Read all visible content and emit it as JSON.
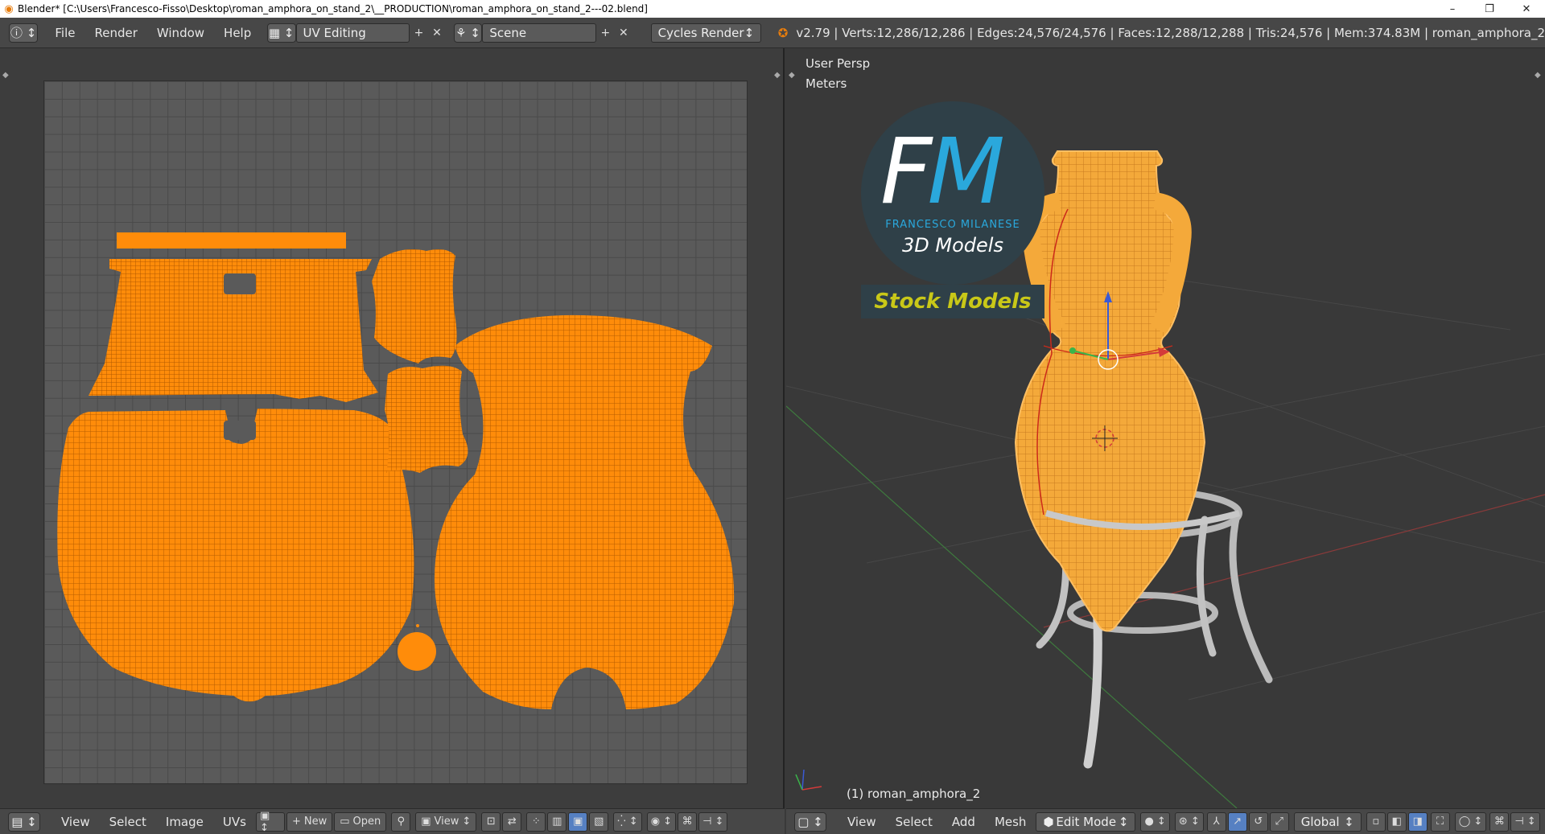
{
  "window": {
    "title": "Blender* [C:\\Users\\Francesco-Fisso\\Desktop\\roman_amphora_on_stand_2\\__PRODUCTION\\roman_amphora_on_stand_2---02.blend]",
    "minimize": "–",
    "maximize": "❐",
    "close": "✕"
  },
  "info_header": {
    "menus": [
      "File",
      "Render",
      "Window",
      "Help"
    ],
    "screen_layout": "UV Editing",
    "scene": "Scene",
    "render_engine": "Cycles Render",
    "stats": "v2.79 | Verts:12,286/12,286 | Edges:24,576/24,576 | Faces:12,288/12,288 | Tris:24,576 | Mem:374.83M | roman_amphora_2"
  },
  "viewport": {
    "view_name": "User Persp",
    "units": "Meters",
    "object_label": "(1) roman_amphora_2"
  },
  "watermark": {
    "letter_f": "F",
    "letter_m": "M",
    "company": "FRANCESCO MILANESE",
    "tagline": "3D Models",
    "badge": "Stock Models"
  },
  "uv_footer": {
    "menus": [
      "View",
      "Select",
      "Image",
      "UVs"
    ],
    "new_label": "New",
    "open_label": "Open",
    "view_label": "View"
  },
  "view3d_footer": {
    "menus": [
      "View",
      "Select",
      "Add",
      "Mesh"
    ],
    "mode": "Edit Mode",
    "orientation": "Global"
  },
  "colors": {
    "uv_orange": "#ff8c0a",
    "mesh_orange": "#f4a93a",
    "axis_x": "#d43a3a",
    "axis_y": "#3ab54a",
    "axis_z": "#3a5ad4"
  }
}
